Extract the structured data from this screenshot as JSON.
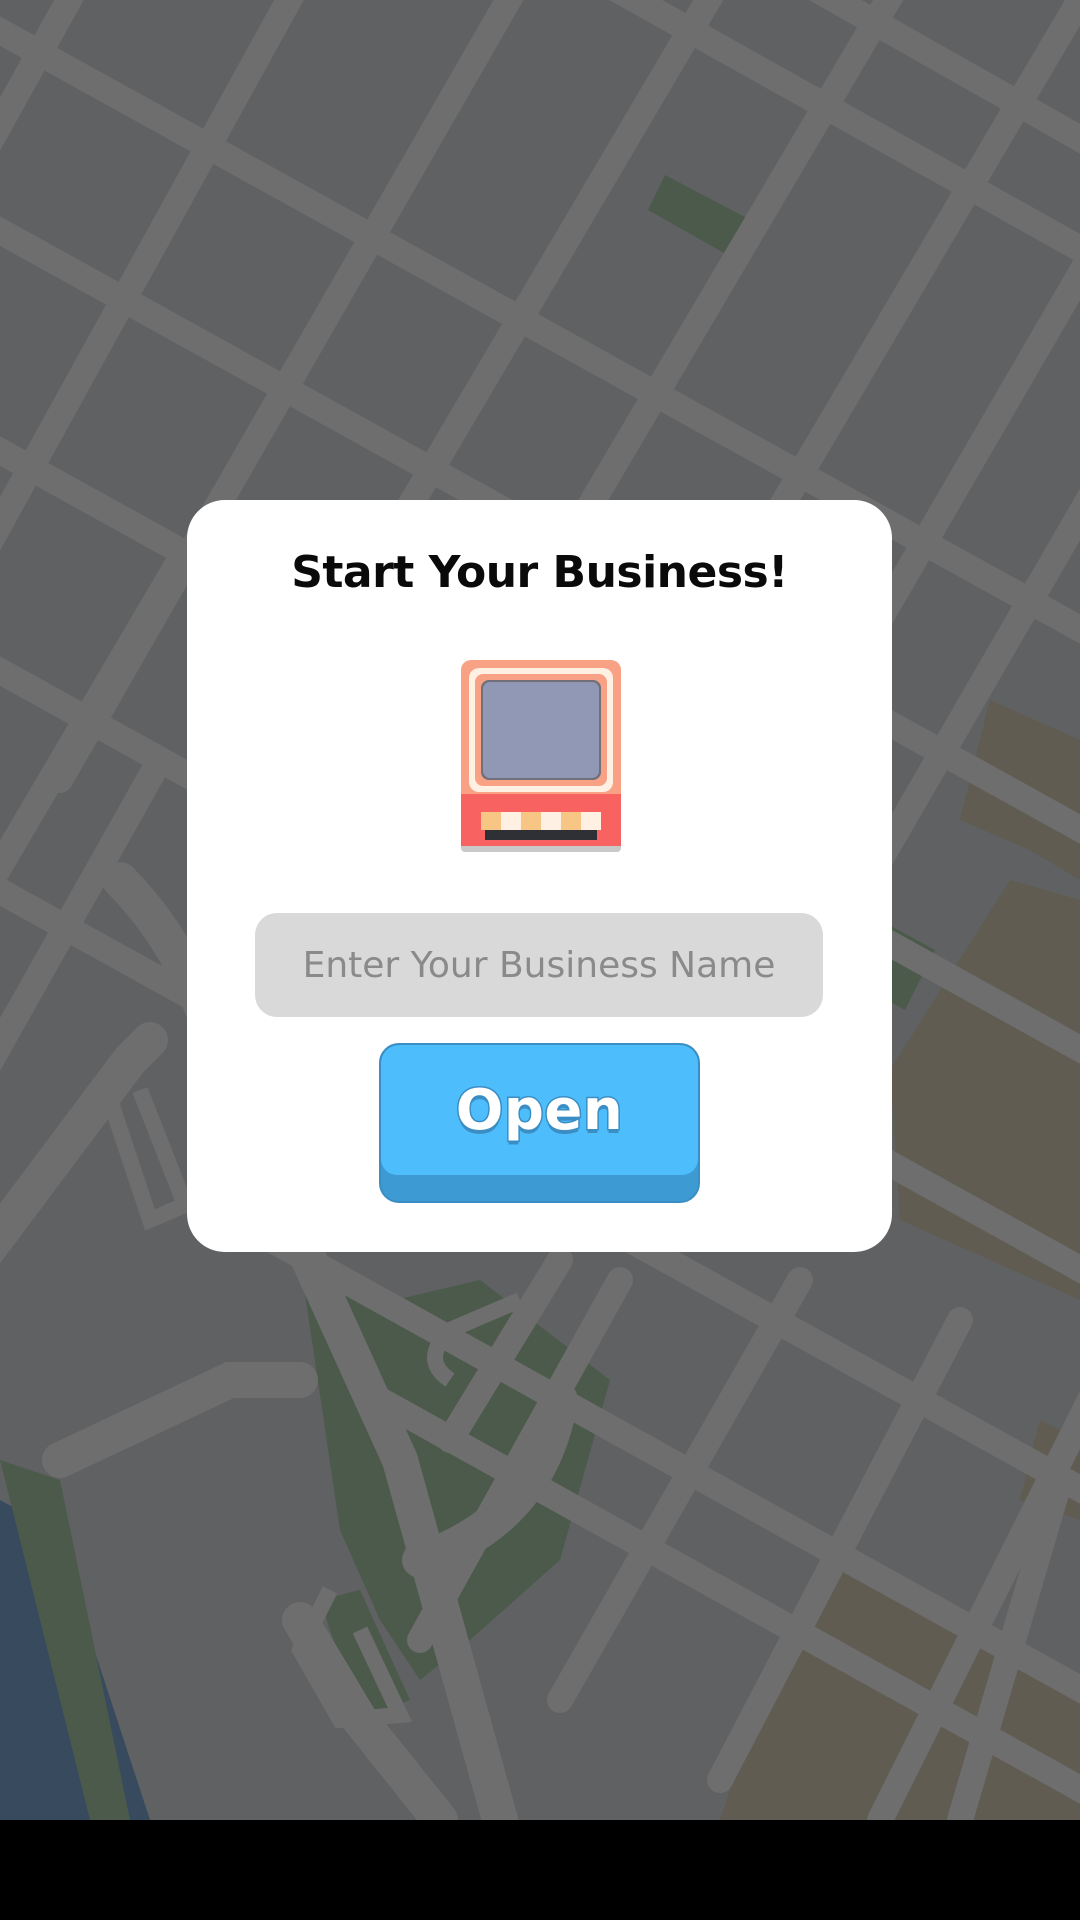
{
  "modal": {
    "title": "Start Your Business!",
    "input": {
      "placeholder": "Enter Your Business Name",
      "value": ""
    },
    "open_button_label": "Open"
  },
  "icons": {
    "shop": "storefront-icon"
  },
  "colors": {
    "map_block": "#606163",
    "map_road": "#6f6f6f",
    "map_park": "#4b5a4b",
    "map_water": "#374a5e",
    "map_sand": "#605c52",
    "modal_bg": "#ffffff",
    "input_bg": "#d9d9d9",
    "button_face": "#4dbdfb",
    "button_edge": "#3d9ad2"
  }
}
